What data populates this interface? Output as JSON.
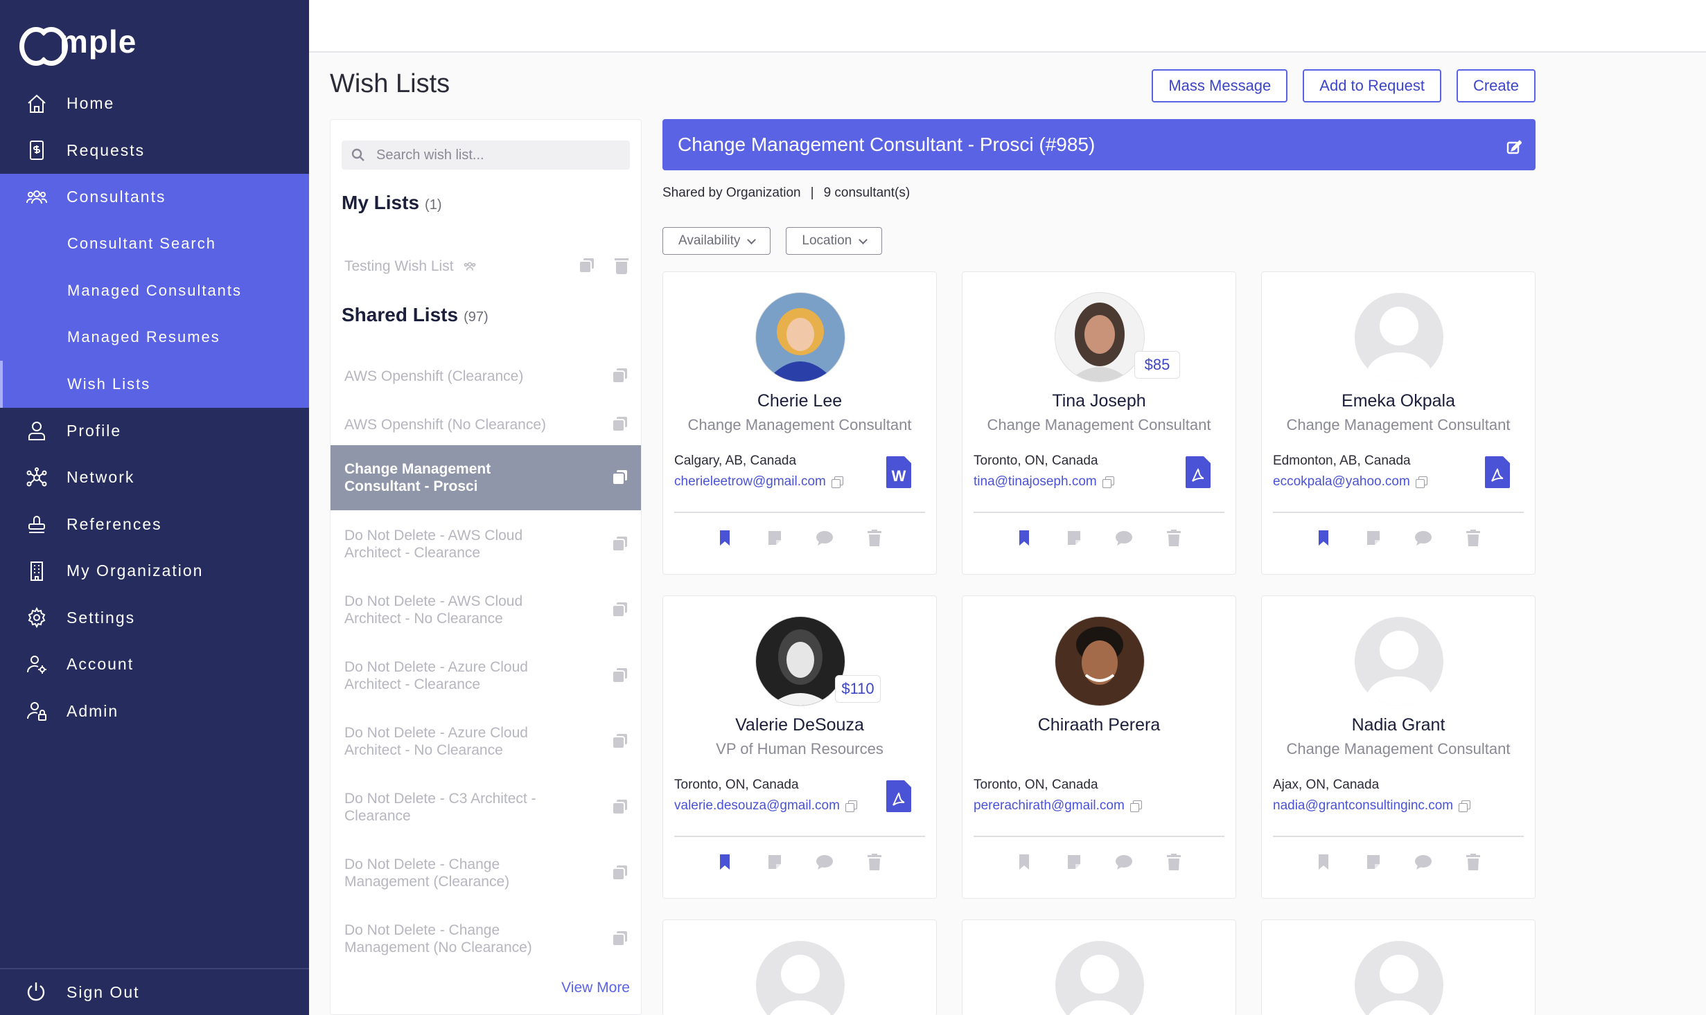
{
  "app": {
    "name": "mple"
  },
  "nav": {
    "items": [
      {
        "label": "Home",
        "icon": "home-icon"
      },
      {
        "label": "Requests",
        "icon": "document-dollar-icon"
      },
      {
        "label": "Consultants",
        "icon": "people-icon"
      },
      {
        "label": "Consultant Search"
      },
      {
        "label": "Managed Consultants"
      },
      {
        "label": "Managed Resumes"
      },
      {
        "label": "Wish Lists"
      },
      {
        "label": "Profile",
        "icon": "person-icon"
      },
      {
        "label": "Network",
        "icon": "network-icon"
      },
      {
        "label": "References",
        "icon": "stamp-icon"
      },
      {
        "label": "My Organization",
        "icon": "building-icon"
      },
      {
        "label": "Settings",
        "icon": "gear-icon"
      },
      {
        "label": "Account",
        "icon": "user-gear-icon"
      },
      {
        "label": "Admin",
        "icon": "user-lock-icon"
      }
    ],
    "sign_out": "Sign Out"
  },
  "page": {
    "title": "Wish Lists",
    "buttons": {
      "mass_message": "Mass Message",
      "add_to_request": "Add to Request",
      "create": "Create"
    }
  },
  "lists_panel": {
    "search_placeholder": "Search wish list...",
    "my_lists_title": "My Lists",
    "my_lists_count": "(1)",
    "my_lists": [
      {
        "label": "Testing Wish List"
      }
    ],
    "shared_title": "Shared Lists",
    "shared_count": "(97)",
    "shared": [
      {
        "label": "AWS Openshift (Clearance)"
      },
      {
        "label": "AWS Openshift (No Clearance)"
      },
      {
        "label": "Change Management Consultant - Prosci"
      },
      {
        "label": "Do Not Delete - AWS Cloud Architect - Clearance"
      },
      {
        "label": "Do Not Delete - AWS Cloud Architect - No Clearance"
      },
      {
        "label": "Do Not Delete - Azure Cloud Architect - Clearance"
      },
      {
        "label": "Do Not Delete - Azure Cloud Architect - No Clearance"
      },
      {
        "label": "Do Not Delete - C3 Architect - Clearance"
      },
      {
        "label": "Do Not Delete - Change Management (Clearance)"
      },
      {
        "label": "Do Not Delete - Change Management (No Clearance)"
      }
    ],
    "view_more": "View More"
  },
  "main": {
    "banner_title": "Change Management Consultant - Prosci (#985)",
    "shared_by": "Shared by Organization",
    "separator": "|",
    "consultant_count": "9 consultant(s)",
    "filters": [
      "Availability",
      "Location"
    ]
  },
  "consultants": [
    {
      "name": "Cherie Lee",
      "role": "Change Management Consultant",
      "location": "Calgary, AB, Canada",
      "email": "cherieleetrow@gmail.com",
      "rate": "",
      "doc": "W",
      "avatar": "photo-woman-blonde",
      "bookmarked": true
    },
    {
      "name": "Tina Joseph",
      "role": "Change Management Consultant",
      "location": "Toronto, ON, Canada",
      "email": "tina@tinajoseph.com",
      "rate": "$85",
      "doc": "pdf",
      "avatar": "photo-woman-dark-hair",
      "bookmarked": true
    },
    {
      "name": "Emeka Okpala",
      "role": "Change Management Consultant",
      "location": "Edmonton, AB, Canada",
      "email": "eccokpala@yahoo.com",
      "rate": "",
      "doc": "pdf",
      "avatar": "placeholder",
      "bookmarked": true
    },
    {
      "name": "Valerie DeSouza",
      "role": "VP of Human Resources",
      "location": "Toronto, ON, Canada",
      "email": "valerie.desouza@gmail.com",
      "rate": "$110",
      "doc": "pdf",
      "avatar": "photo-woman-bw",
      "bookmarked": true
    },
    {
      "name": "Chiraath Perera",
      "role": "",
      "location": "Toronto, ON, Canada",
      "email": "pererachirath@gmail.com",
      "rate": "",
      "doc": "",
      "avatar": "photo-man",
      "bookmarked": false
    },
    {
      "name": "Nadia Grant",
      "role": "Change Management Consultant",
      "location": "Ajax, ON, Canada",
      "email": "nadia@grantconsultinginc.com",
      "rate": "",
      "doc": "",
      "avatar": "placeholder",
      "bookmarked": false
    }
  ],
  "colors": {
    "sidebar": "#262d5e",
    "accent": "#5b63e5",
    "selected_list": "#9096a9"
  }
}
